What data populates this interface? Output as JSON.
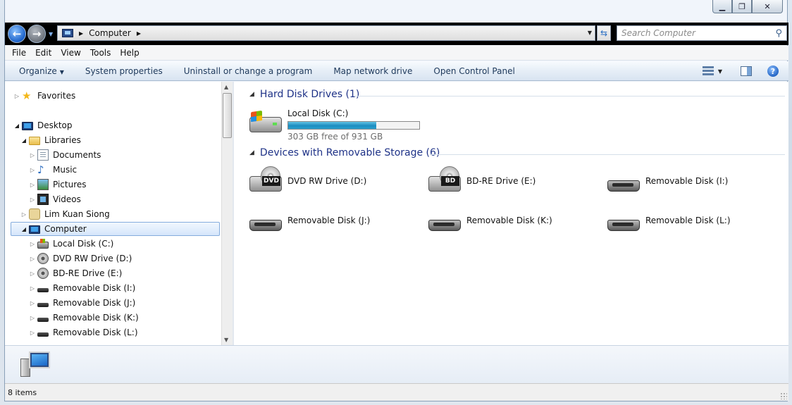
{
  "window": {
    "caption_buttons": [
      "minimize",
      "maximize",
      "close"
    ]
  },
  "address_bar": {
    "location": "Computer",
    "search_placeholder": "Search Computer"
  },
  "menu": [
    "File",
    "Edit",
    "View",
    "Tools",
    "Help"
  ],
  "command_bar": {
    "organize": "Organize",
    "system_properties": "System properties",
    "uninstall": "Uninstall or change a program",
    "map_drive": "Map network drive",
    "control_panel": "Open Control Panel"
  },
  "nav_tree": {
    "favorites": "Favorites",
    "desktop": "Desktop",
    "libraries": "Libraries",
    "documents": "Documents",
    "music": "Music",
    "pictures": "Pictures",
    "videos": "Videos",
    "user": "Lim Kuan Siong",
    "computer": "Computer",
    "drive_c": "Local Disk (C:)",
    "drive_d": "DVD RW Drive (D:)",
    "drive_e": "BD-RE Drive (E:)",
    "drive_i": "Removable Disk (I:)",
    "drive_j": "Removable Disk (J:)",
    "drive_k": "Removable Disk (K:)",
    "drive_l": "Removable Disk (L:)"
  },
  "content": {
    "hdd_header": "Hard Disk Drives (1)",
    "removable_header": "Devices with Removable Storage (6)",
    "local_disk": {
      "name": "Local Disk (C:)",
      "free_text": "303 GB free of 931 GB",
      "used_fraction": 0.674
    },
    "dvd": {
      "name": "DVD RW Drive (D:)",
      "badge": "DVD"
    },
    "bd": {
      "name": "BD-RE Drive (E:)",
      "badge": "BD"
    },
    "rem_i": "Removable Disk (I:)",
    "rem_j": "Removable Disk (J:)",
    "rem_k": "Removable Disk (K:)",
    "rem_l": "Removable Disk (L:)"
  },
  "status": {
    "items": "8 items"
  },
  "colors": {
    "group_header": "#1e3287",
    "capacity_fill": "#1c8cbf",
    "selection": "#d5e6fb"
  }
}
